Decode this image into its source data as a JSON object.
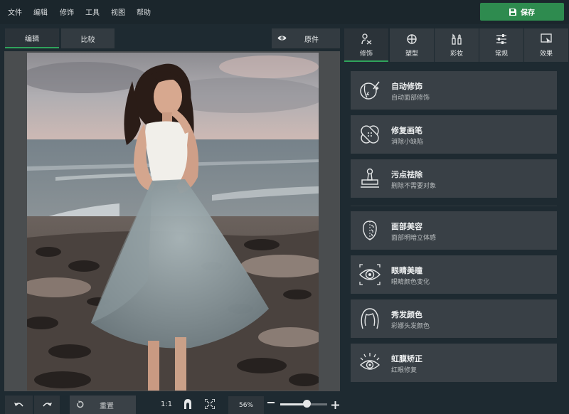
{
  "menu": [
    "文件",
    "编辑",
    "修饰",
    "工具",
    "视图",
    "帮助"
  ],
  "save_label": "保存",
  "view_tabs": [
    {
      "label": "编辑",
      "active": true
    },
    {
      "label": "比较",
      "active": false
    }
  ],
  "original_label": "原件",
  "bottom": {
    "reset_label": "重置",
    "ratio_label": "1:1",
    "zoom_label": "56%",
    "zoom_value": 0.56
  },
  "panel_tabs": [
    {
      "label": "修饰",
      "icon": "bandage-icon",
      "active": true
    },
    {
      "label": "塑型",
      "icon": "target-icon",
      "active": false
    },
    {
      "label": "彩妆",
      "icon": "makeup-icon",
      "active": false
    },
    {
      "label": "常规",
      "icon": "sliders-icon",
      "active": false
    },
    {
      "label": "效果",
      "icon": "effects-icon",
      "active": false
    }
  ],
  "tools": [
    {
      "name": "自动修饰",
      "desc": "自动面部修饰",
      "icon": "face-magic-icon"
    },
    {
      "name": "修复画笔",
      "desc": "消除小缺陷",
      "icon": "bandage-icon"
    },
    {
      "name": "污点祛除",
      "desc": "删除不需要对象",
      "icon": "stamp-icon"
    },
    {
      "name": "面部美容",
      "desc": "面部明暗立体感",
      "icon": "face-contour-icon"
    },
    {
      "name": "眼睛美瞳",
      "desc": "眼睛颜色变化",
      "icon": "eye-color-icon"
    },
    {
      "name": "秀发颜色",
      "desc": "彩娜头发颜色",
      "icon": "hair-icon"
    },
    {
      "name": "虹膜矫正",
      "desc": "红眼修复",
      "icon": "red-eye-icon"
    }
  ],
  "colors": {
    "accent": "#2fa35b",
    "save": "#2e8b4f",
    "bg": "#1e2a31"
  }
}
